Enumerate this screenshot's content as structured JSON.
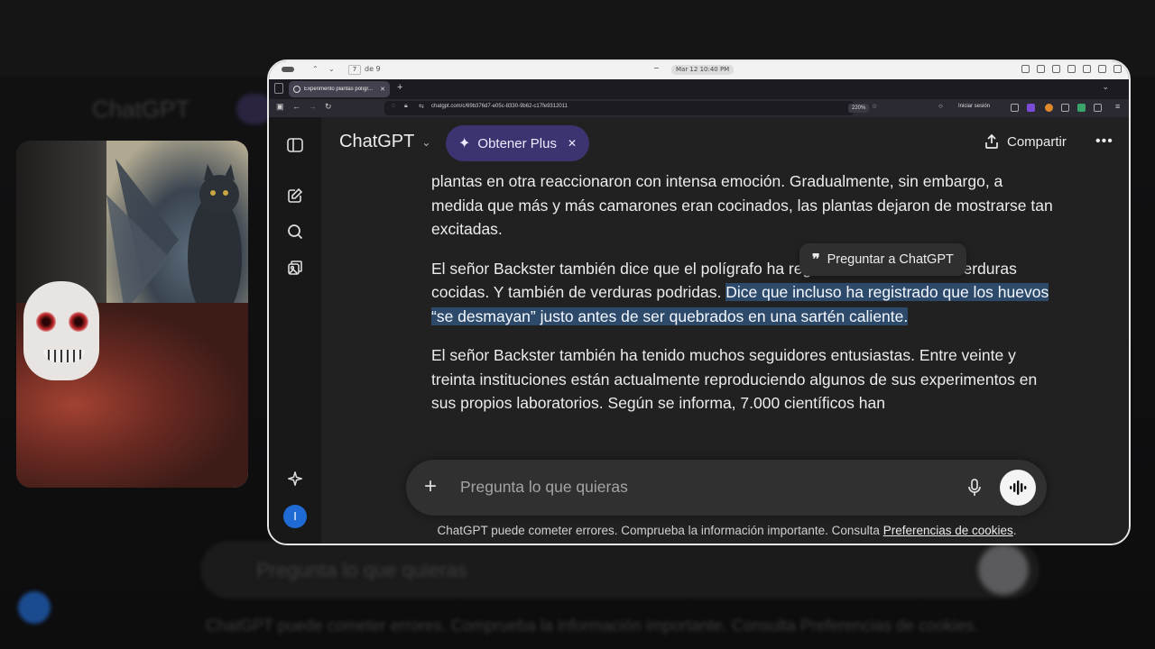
{
  "os_bar": {
    "page_number": "7",
    "page_total": "de 9",
    "datetime": "Mar 12  10:40 PM"
  },
  "browser": {
    "tab_title": "Experimento plantas polígr...",
    "url": "chatgpt.com/c/69b376d7-e05c-8330-9b62-c17fe9312011",
    "zoom": "220%",
    "signin": "Iniciar sesión"
  },
  "app": {
    "brand": "ChatGPT",
    "plus_label": "Obtener Plus",
    "share_label": "Compartir",
    "avatar_letter": "I"
  },
  "message": {
    "p1": "plantas en otra reaccionaron con intensa emoción. Gradualmente, sin embargo, a medida que más y más camarones eran cocinados, las plantas dejaron de mostrarse tan excitadas.",
    "p2_start": "El señor Backster también dice que el polígrafo ha registrado la muerte de verduras cocidas. Y también de verduras podridas. ",
    "p2_highlight": "Dice que incluso ha registrado que los huevos “se desmayan” justo antes de ser quebrados en una sartén caliente.",
    "p3": "El señor Backster también ha tenido muchos seguidores entusiastas. Entre veinte y treinta instituciones están actualmente reproduciendo algunos de sus experimentos en sus propios laboratorios. Según se informa, 7.000 científicos han"
  },
  "tooltip": {
    "label": "Preguntar a ChatGPT"
  },
  "composer": {
    "placeholder": "Pregunta lo que quieras"
  },
  "footer": {
    "text": "ChatGPT puede cometer errores. Comprueba la información importante. Consulta ",
    "link": "Preferencias de cookies",
    "end": "."
  },
  "background": {
    "logo": "ChatGPT",
    "input_placeholder": "Pregunta lo que quieras",
    "footer": "ChatGPT puede cometer errores. Comprueba la información importante. Consulta Preferencias de cookies."
  },
  "colors": {
    "accent_plus": "#3c3470",
    "highlight": "#2d4a6b",
    "avatar": "#1f6bd6"
  }
}
